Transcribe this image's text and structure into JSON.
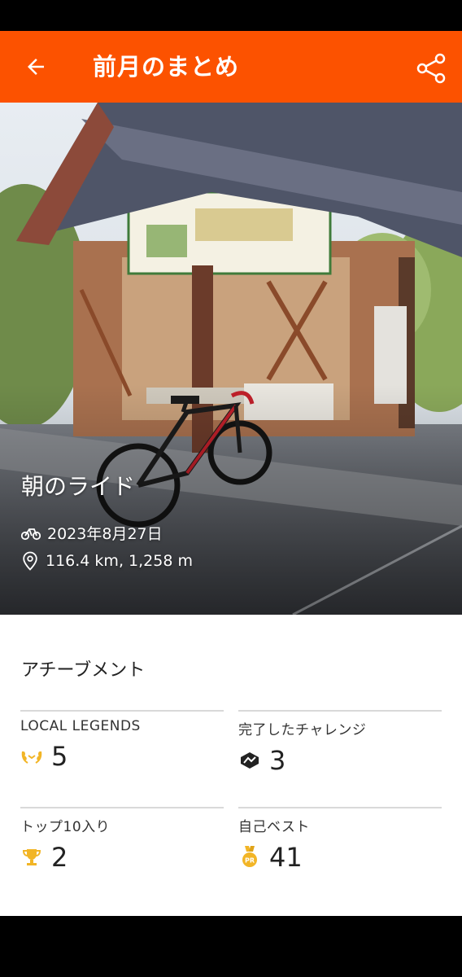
{
  "header": {
    "title": "前月のまとめ"
  },
  "activity": {
    "name": "朝のライド",
    "date": "2023年8月27日",
    "distance": "116.4 km, 1,258 m"
  },
  "achievements": {
    "title": "アチーブメント",
    "stats": [
      {
        "label": "LOCAL LEGENDS",
        "value": "5",
        "icon": "laurel-icon"
      },
      {
        "label": "完了したチャレンジ",
        "value": "3",
        "icon": "challenge-badge-icon"
      },
      {
        "label": "トップ10入り",
        "value": "2",
        "icon": "trophy-icon"
      },
      {
        "label": "自己ベスト",
        "value": "41",
        "icon": "pr-medal-icon"
      }
    ]
  },
  "colors": {
    "brand": "#fc5200",
    "gold": "#f2b526"
  }
}
